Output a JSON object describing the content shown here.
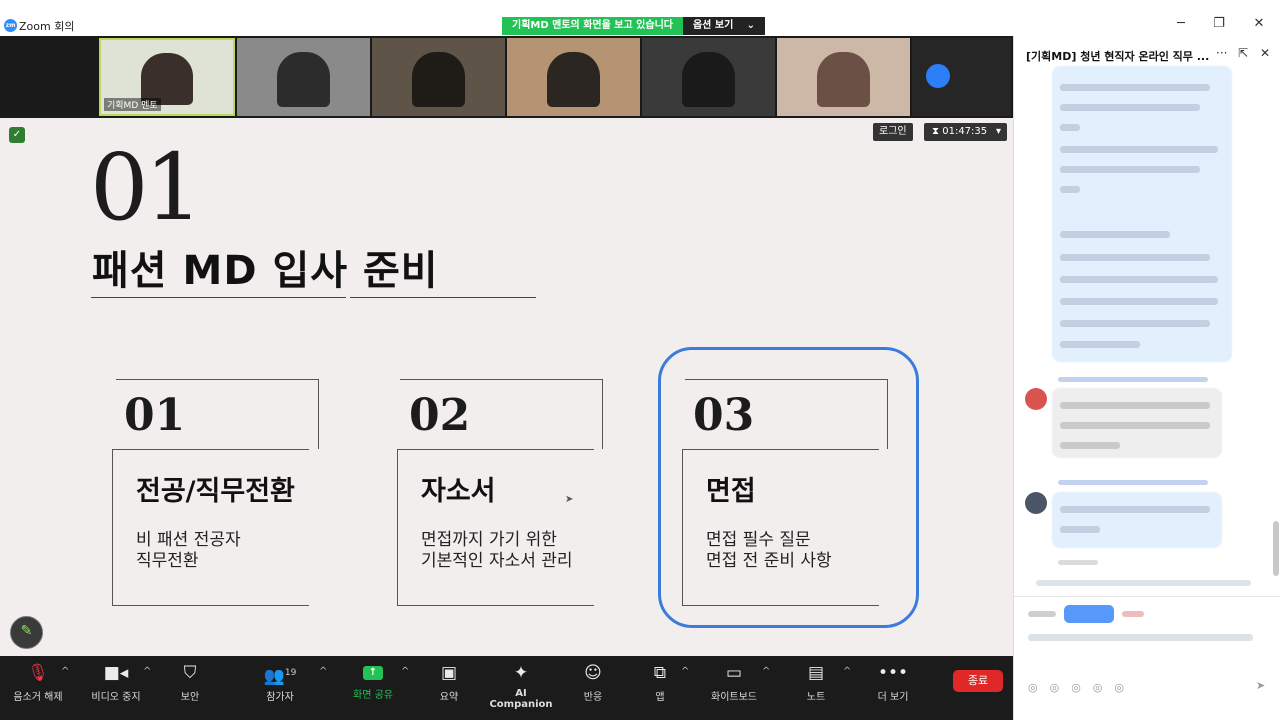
{
  "window": {
    "title": "Zoom 회의",
    "logo_text": "zm",
    "share_banner_text": "기획MD 멘토의 화면을 보고 있습니다",
    "options_label": "옵션 보기"
  },
  "gallery": {
    "active_speaker_name": "기획MD 멘토"
  },
  "slide_header": {
    "login_label": "로그인",
    "timer_value": "01:47:35"
  },
  "slide": {
    "big_number": "01",
    "title": "패션 MD 입사 준비",
    "cards": [
      {
        "num": "01",
        "heading": "전공/직무전환",
        "line1": "비 패션 전공자",
        "line2": "직무전환"
      },
      {
        "num": "02",
        "heading": "자소서",
        "line1": "면접까지 가기 위한",
        "line2": "기본적인 자소서 관리"
      },
      {
        "num": "03",
        "heading": "면접",
        "line1": "면접 필수 질문",
        "line2": "면접 전 준비 사항"
      }
    ]
  },
  "toolbar": {
    "unmute": "음소거 해제",
    "video_stop": "비디오 중지",
    "security": "보안",
    "participants": "참가자",
    "participants_count": "19",
    "share_screen": "화면 공유",
    "summary": "요약",
    "ai_companion": "AI Companion",
    "reactions": "반응",
    "apps": "앱",
    "whiteboard": "화이트보드",
    "notes": "노트",
    "more": "더 보기",
    "end": "종료"
  },
  "chat": {
    "title": "[기획MD] 청년 현직자 온라인 직무 ..."
  },
  "colors": {
    "share_green": "#23c256",
    "end_red": "#e02828",
    "highlight_blue": "#3a7bdc",
    "slide_bg": "#f2eeee"
  }
}
